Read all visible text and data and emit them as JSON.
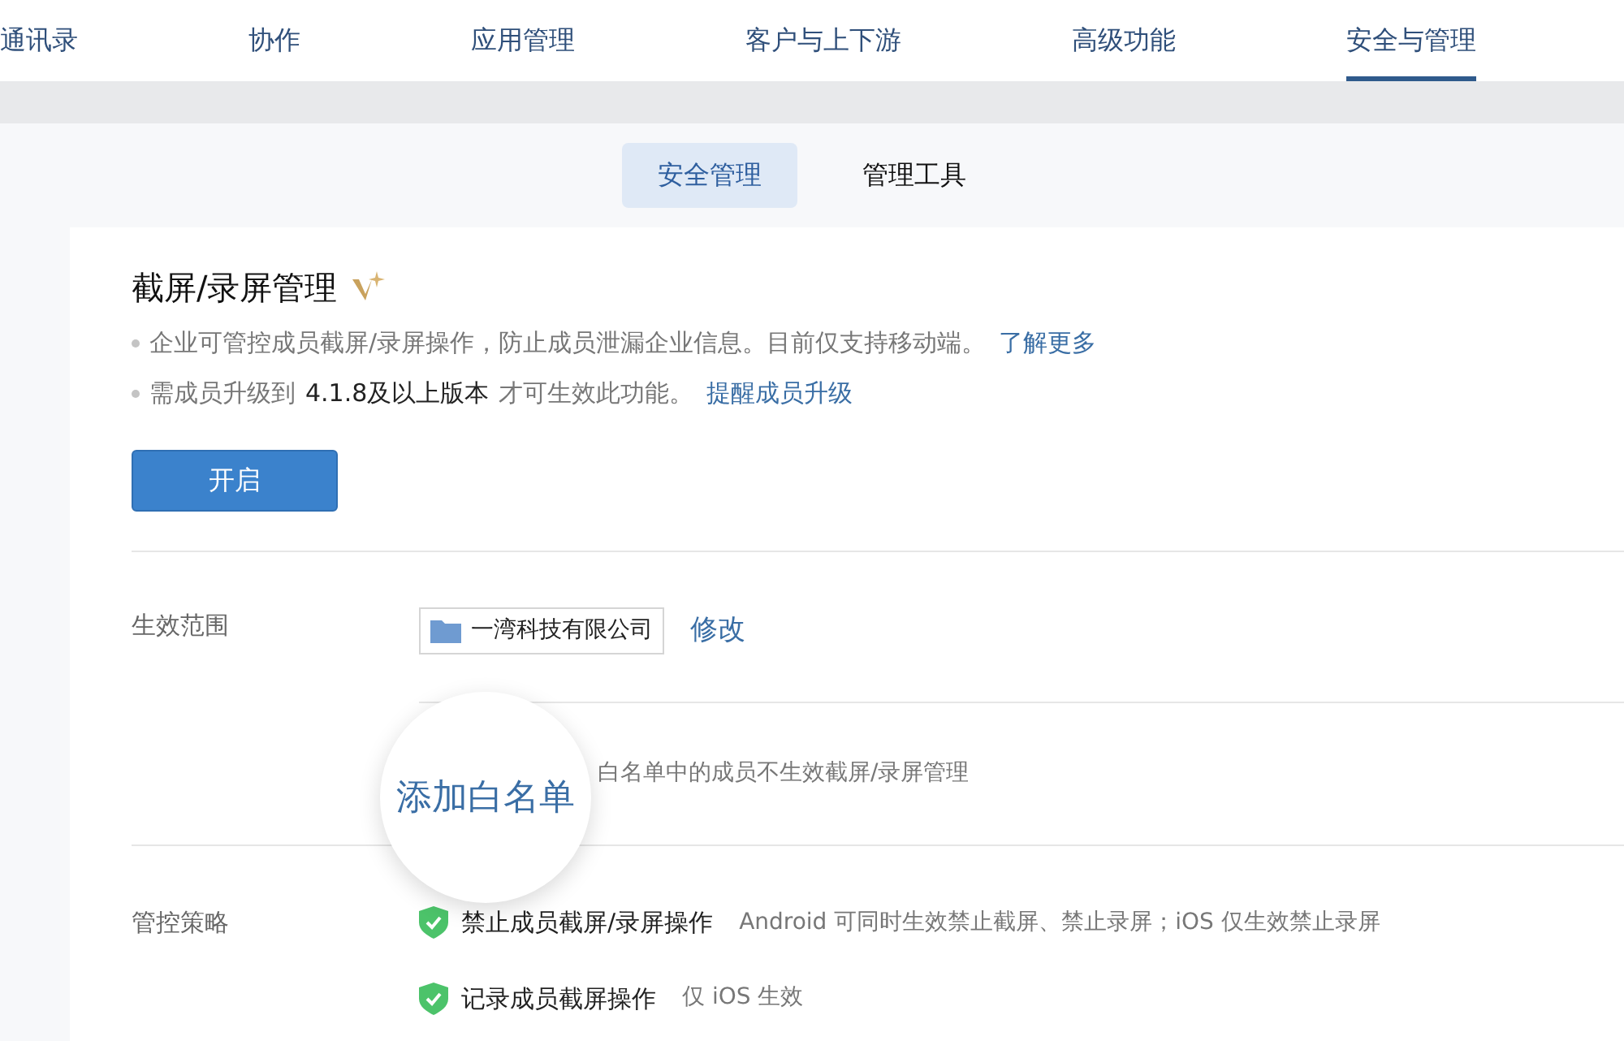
{
  "nav_tabs": [
    {
      "label": "通讯录",
      "selected": false
    },
    {
      "label": "协作",
      "selected": false
    },
    {
      "label": "应用管理",
      "selected": false
    },
    {
      "label": "客户与上下游",
      "selected": false
    },
    {
      "label": "高级功能",
      "selected": false
    },
    {
      "label": "安全与管理",
      "selected": true
    }
  ],
  "sub_tabs": [
    {
      "label": "安全管理",
      "selected": true
    },
    {
      "label": "管理工具",
      "selected": false
    }
  ],
  "feature": {
    "title": "截屏/录屏管理",
    "bullets": [
      [
        {
          "kind": "plain",
          "text": "企业可管控成员截屏/录屏操作，防止成员泄漏企业信息。目前仅支持移动端。"
        },
        {
          "kind": "link",
          "text": "了解更多"
        }
      ],
      [
        {
          "kind": "plain",
          "text": "需成员升级到"
        },
        {
          "kind": "strong",
          "text": "4.1.8及以上版本"
        },
        {
          "kind": "plain",
          "text": "才可生效此功能。"
        },
        {
          "kind": "link",
          "text": "提醒成员升级"
        }
      ]
    ],
    "button": "开启"
  },
  "scope": {
    "label": "生效范围",
    "department": "一湾科技有限公司",
    "edit_link": "修改"
  },
  "whitelist": {
    "link": "添加白名单",
    "description": "白名单中的成员不生效截屏/录屏管理"
  },
  "policy": {
    "label": "管控策略",
    "items": [
      {
        "label": "禁止成员截屏/录屏操作",
        "note": "Android 可同时生效禁止截屏、禁止录屏；iOS 仅生效禁止录屏",
        "checked": true
      },
      {
        "label": "记录成员截屏操作",
        "note": "仅 iOS 生效",
        "checked": true
      }
    ]
  }
}
